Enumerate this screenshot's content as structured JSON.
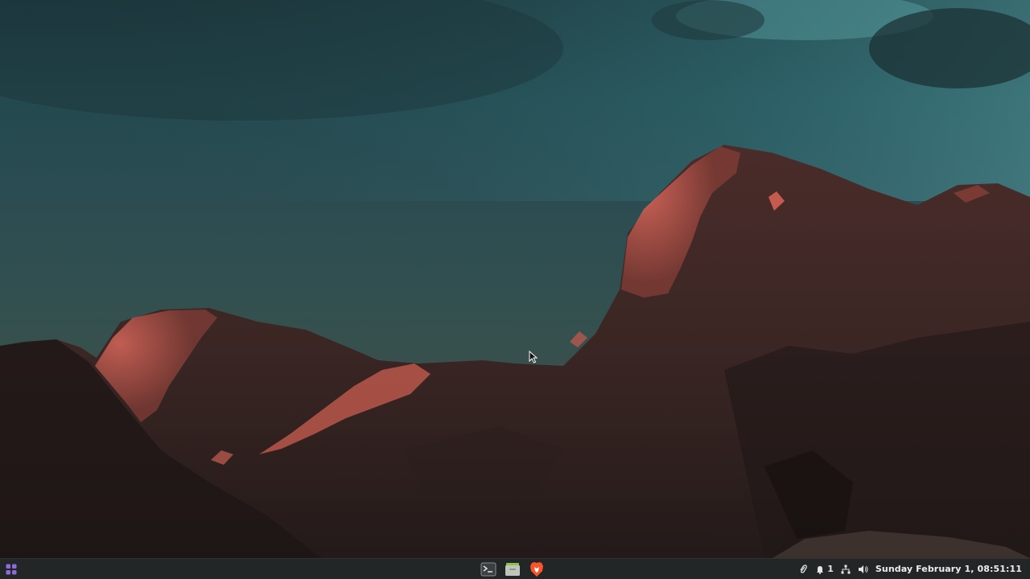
{
  "desktop": {
    "wallpaper": "mountain-ridge-at-dusk"
  },
  "taskbar": {
    "launchers": [
      {
        "name": "terminal",
        "icon": "terminal-icon"
      },
      {
        "name": "files",
        "icon": "folder-icon"
      },
      {
        "name": "brave-browser",
        "icon": "brave-lion-icon"
      }
    ],
    "tray": {
      "notification_count": "1",
      "clock": "Sunday February 1, 08:51:11"
    }
  },
  "colors": {
    "taskbar_bg": "#232627",
    "menu_accent": "#8e6bd8",
    "brave_orange": "#fb542b",
    "rock_highlight": "#c9574c",
    "sky_top": "#1d3b40"
  }
}
